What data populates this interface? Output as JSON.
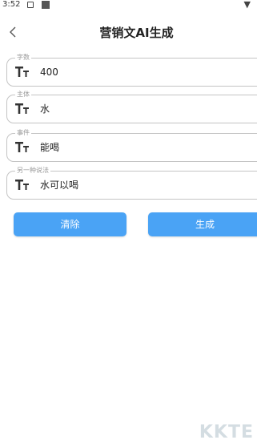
{
  "status_bar": {
    "time": "3:52"
  },
  "header": {
    "title": "营销文AI生成"
  },
  "fields": [
    {
      "label": "字数",
      "value": "400"
    },
    {
      "label": "主体",
      "value": "水"
    },
    {
      "label": "事件",
      "value": "能喝"
    },
    {
      "label": "另一种说法",
      "value": "水可以喝"
    }
  ],
  "buttons": {
    "clear_label": "清除",
    "generate_label": "生成"
  },
  "watermark": {
    "text": "KKTE"
  },
  "colors": {
    "accent": "#4aa3f5",
    "border": "#c4c4c4"
  }
}
